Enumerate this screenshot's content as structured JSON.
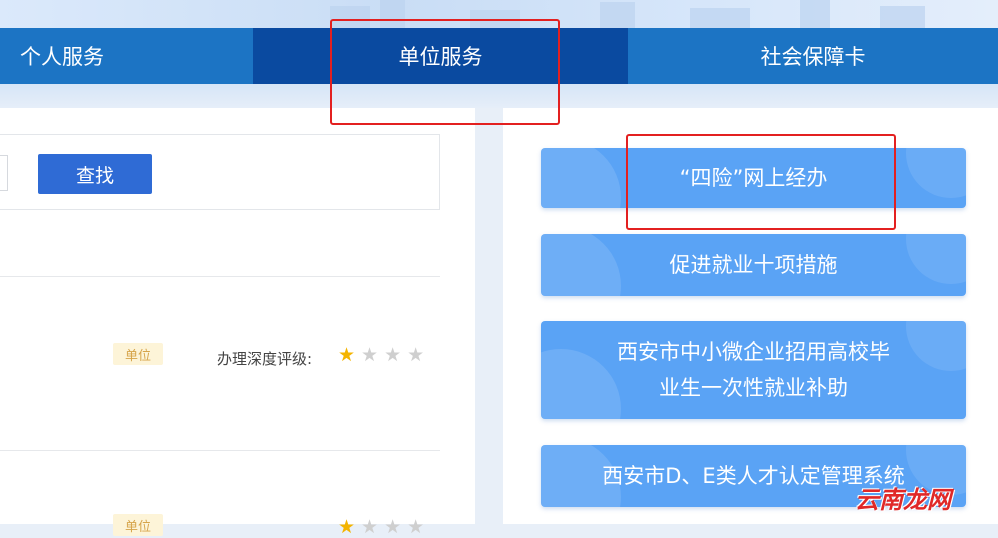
{
  "nav": {
    "tabs": [
      {
        "label": "个人服务"
      },
      {
        "label": "单位服务"
      },
      {
        "label": "社会保障卡"
      }
    ]
  },
  "search": {
    "button_label": "查找"
  },
  "list": {
    "items": [
      {
        "tag": "单位",
        "rating_label": "办理深度评级:",
        "rating": 1,
        "rating_max": 4
      },
      {
        "tag": "单位",
        "rating_label": "",
        "rating": 1,
        "rating_max": 4
      }
    ]
  },
  "quick_links": [
    {
      "label": "“四险”网上经办"
    },
    {
      "label": "促进就业十项措施"
    },
    {
      "label_line1": "西安市中小微企业招用高校毕",
      "label_line2": "业生一次性就业补助"
    },
    {
      "label": "西安市D、E类人才认定管理系统"
    }
  ],
  "watermark": "云南龙网",
  "colors": {
    "nav_bg": "#1c74c4",
    "nav_active": "#0a4aa0",
    "search_button": "#2f6bd5",
    "quick_link_bg": "#5aa3f5",
    "highlight": "#e32020",
    "star_on": "#f4b400"
  }
}
